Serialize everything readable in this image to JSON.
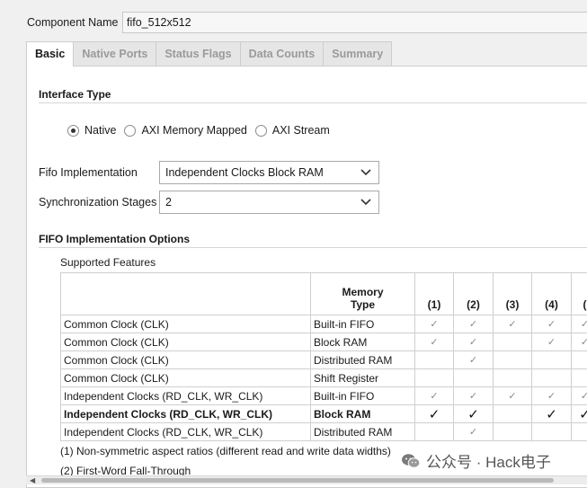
{
  "component": {
    "label": "Component Name",
    "value": "fifo_512x512"
  },
  "tabs": [
    {
      "label": "Basic",
      "active": true
    },
    {
      "label": "Native Ports",
      "active": false
    },
    {
      "label": "Status Flags",
      "active": false
    },
    {
      "label": "Data Counts",
      "active": false
    },
    {
      "label": "Summary",
      "active": false
    }
  ],
  "interface_type": {
    "title": "Interface Type",
    "options": [
      {
        "label": "Native",
        "selected": true
      },
      {
        "label": "AXI Memory Mapped",
        "selected": false
      },
      {
        "label": "AXI Stream",
        "selected": false
      }
    ]
  },
  "fifo_impl": {
    "label": "Fifo Implementation",
    "value": "Independent Clocks Block RAM"
  },
  "sync_stages": {
    "label": "Synchronization Stages",
    "value": "2"
  },
  "impl_options": {
    "title": "FIFO Implementation Options",
    "features_label": "Supported Features",
    "columns": [
      "",
      "Memory\nType",
      "(1)",
      "(2)",
      "(3)",
      "(4)",
      "("
    ],
    "check_glyph": "✓",
    "rows": [
      {
        "clock": "Common Clock (CLK)",
        "memory": "Built-in FIFO",
        "checks": [
          true,
          true,
          true,
          true,
          true
        ],
        "bold": false
      },
      {
        "clock": "Common Clock (CLK)",
        "memory": "Block RAM",
        "checks": [
          true,
          true,
          false,
          true,
          true
        ],
        "bold": false
      },
      {
        "clock": "Common Clock (CLK)",
        "memory": "Distributed RAM",
        "checks": [
          false,
          true,
          false,
          false,
          false
        ],
        "bold": false
      },
      {
        "clock": "Common Clock (CLK)",
        "memory": "Shift Register",
        "checks": [
          false,
          false,
          false,
          false,
          false
        ],
        "bold": false
      },
      {
        "clock": "Independent Clocks (RD_CLK, WR_CLK)",
        "memory": "Built-in FIFO",
        "checks": [
          true,
          true,
          true,
          true,
          true
        ],
        "bold": false
      },
      {
        "clock": "Independent Clocks (RD_CLK, WR_CLK)",
        "memory": "Block RAM",
        "checks": [
          true,
          true,
          false,
          true,
          true
        ],
        "bold": true
      },
      {
        "clock": "Independent Clocks (RD_CLK, WR_CLK)",
        "memory": "Distributed RAM",
        "checks": [
          false,
          true,
          false,
          false,
          false
        ],
        "bold": false
      }
    ],
    "footnotes": [
      "(1) Non-symmetric aspect ratios (different read and write data widths)",
      "(2) First-Word Fall-Through"
    ]
  },
  "watermark": {
    "text": "公众号 · Hack电子",
    "icon": "wechat-icon"
  },
  "colors": {
    "panel_bg": "#ffffff",
    "window_bg": "#f0f0f0",
    "border": "#cdcdcd",
    "inactive_tab_text": "#9a9a9a"
  }
}
